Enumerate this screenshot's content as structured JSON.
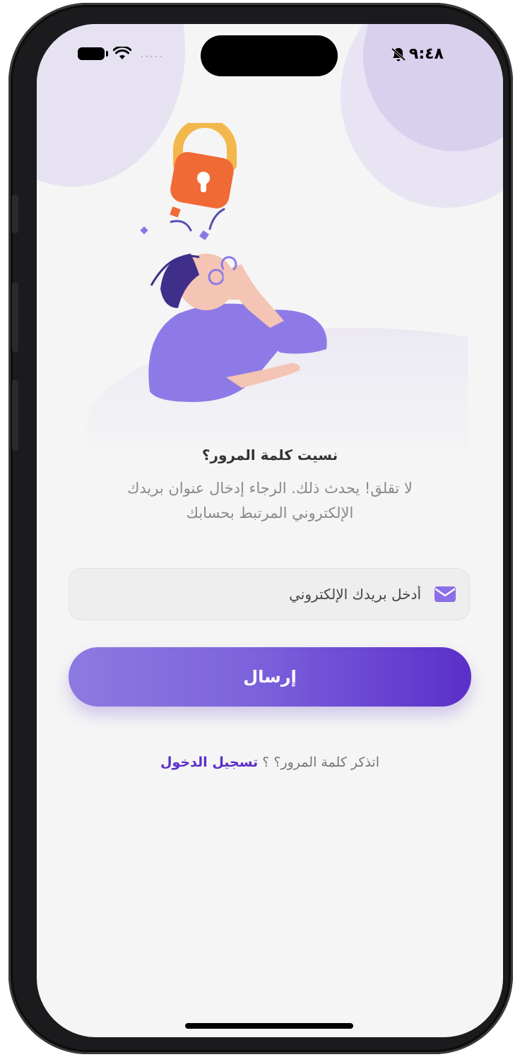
{
  "status_bar": {
    "time": "٩:٤٨",
    "signal_dots": "....."
  },
  "forgot": {
    "title": "نسيت كلمة المرور؟",
    "subtitle": "لا تقلق! يحدث ذلك. الرجاء إدخال عنوان بريدك الإلكتروني المرتبط بحسابك"
  },
  "email": {
    "placeholder": "أدخل بريدك الإلكتروني",
    "value": ""
  },
  "send_button": {
    "label": "إرسال"
  },
  "remember": {
    "prefix": "اتذكر كلمة المرور؟ ؟",
    "link": "تسجيل الدخول"
  },
  "colors": {
    "accent": "#5b2fc9",
    "accent_light": "#8d7ae0",
    "background": "#f5f5f5",
    "lock": "#f06a35"
  }
}
